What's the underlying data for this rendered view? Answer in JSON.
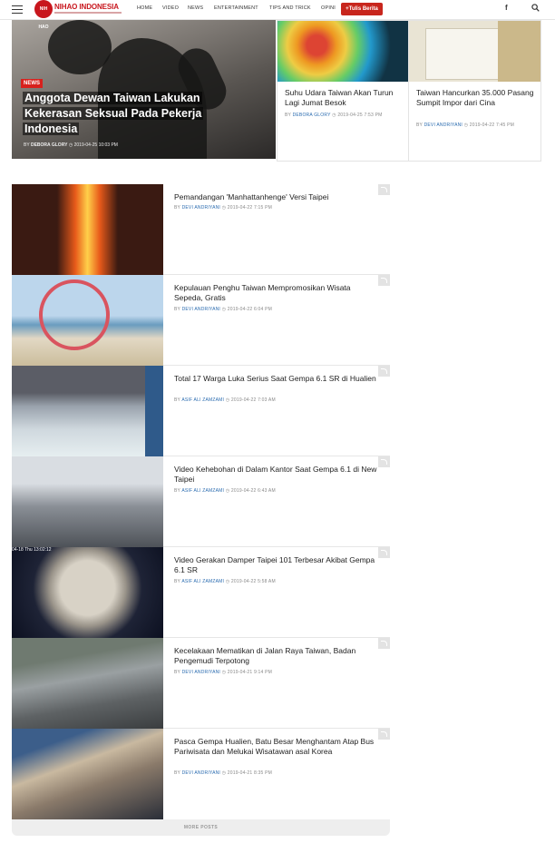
{
  "header": {
    "logo_badge": "NIH HAO",
    "logo_text": "NIHAO INDONESIA",
    "nav": [
      "HOME",
      "VIDEO",
      "NEWS",
      "ENTERTAINMENT",
      "TIPS AND TRICK",
      "OPINI"
    ],
    "cta": "+Tulis Berita",
    "facebook": "f"
  },
  "featured": {
    "badge": "NEWS",
    "title": "Anggota Dewan Taiwan Lakukan Kekerasan Seksual Pada Pekerja Indonesia",
    "by": "BY",
    "author": "DEBORA GLORY",
    "date": "2019-04-25 10:03 PM"
  },
  "cards": [
    {
      "title": "Suhu Udara Taiwan Akan Turun Lagi Jumat Besok",
      "by": "BY",
      "author": "DEBORA GLORY",
      "date": "2019-04-25 7:53 PM"
    },
    {
      "title": "Taiwan Hancurkan 35.000 Pasang Sumpit Impor dari Cina",
      "by": "BY",
      "author": "DEVI ANDRIYANI",
      "date": "2019-04-22 7:45 PM"
    }
  ],
  "posts": [
    {
      "title": "Pemandangan 'Manhattanhenge' Versi Taipei",
      "by": "BY",
      "author": "DEVI ANDRIYANI",
      "date": "2019-04-22 7:15 PM"
    },
    {
      "title": "Kepulauan Penghu Taiwan Mempromosikan Wisata Sepeda, Gratis",
      "by": "BY",
      "author": "DEVI ANDRIYANI",
      "date": "2019-04-22 6:04 PM"
    },
    {
      "title": "Total 17 Warga Luka Serius Saat Gempa 6.1 SR di Hualien",
      "by": "BY",
      "author": "ASIF ALI ZAMZAMI",
      "date": "2019-04-22 7:03 AM"
    },
    {
      "title": "Video Kehebohan di Dalam Kantor Saat Gempa 6.1 di New Taipei",
      "by": "BY",
      "author": "ASIF ALI ZAMZAMI",
      "date": "2019-04-22 6:43 AM"
    },
    {
      "title": "Video Gerakan Damper Taipei 101 Terbesar Akibat Gempa 6.1 SR",
      "by": "BY",
      "author": "ASIF ALI ZAMZAMI",
      "date": "2019-04-22 5:58 AM"
    },
    {
      "title": "Kecelakaan Mematikan di Jalan Raya Taiwan, Badan Pengemudi Terpotong",
      "by": "BY",
      "author": "DEVI ANDRIYANI",
      "date": "2019-04-21 9:14 PM"
    },
    {
      "title": "Pasca Gempa Hualien, Batu Besar Menghantam Atap Bus Pariwisata dan Melukai Wisatawan asal Korea",
      "by": "BY",
      "author": "DEVI ANDRIYANI",
      "date": "2019-04-21 8:35 PM"
    }
  ],
  "damper_timestamp": "04-18 Thu 13:02:12",
  "more_posts": "MORE POSTS",
  "colors": {
    "brand": "#c8161d",
    "author_link": "#2b6cb0",
    "badge": "#d8201d"
  }
}
